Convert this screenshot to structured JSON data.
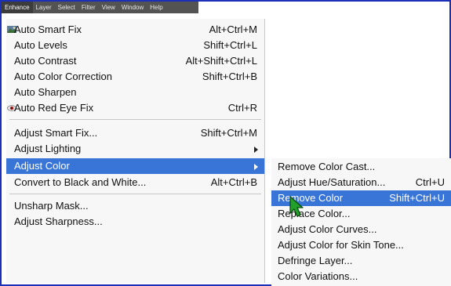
{
  "menubar": {
    "items": [
      "Enhance",
      "Layer",
      "Select",
      "Filter",
      "View",
      "Window",
      "Help"
    ]
  },
  "enhance_menu": {
    "items": [
      {
        "label": "Auto Smart Fix",
        "shortcut": "Alt+Ctrl+M",
        "icon": "auto-smart-fix-icon"
      },
      {
        "label": "Auto Levels",
        "shortcut": "Shift+Ctrl+L"
      },
      {
        "label": "Auto Contrast",
        "shortcut": "Alt+Shift+Ctrl+L"
      },
      {
        "label": "Auto Color Correction",
        "shortcut": "Shift+Ctrl+B"
      },
      {
        "label": "Auto Sharpen",
        "shortcut": ""
      },
      {
        "label": "Auto Red Eye Fix",
        "shortcut": "Ctrl+R",
        "icon": "red-eye-icon"
      },
      {
        "label": "Adjust Smart Fix...",
        "shortcut": "Shift+Ctrl+M"
      },
      {
        "label": "Adjust Lighting",
        "shortcut": "",
        "submenu": true
      },
      {
        "label": "Adjust Color",
        "shortcut": "",
        "submenu": true,
        "selected": true
      },
      {
        "label": "Convert to Black and White...",
        "shortcut": "Alt+Ctrl+B"
      },
      {
        "label": "Unsharp Mask...",
        "shortcut": ""
      },
      {
        "label": "Adjust Sharpness...",
        "shortcut": ""
      }
    ]
  },
  "adjust_color_submenu": {
    "items": [
      {
        "label": "Remove Color Cast...",
        "shortcut": ""
      },
      {
        "label": "Adjust Hue/Saturation...",
        "shortcut": "Ctrl+U"
      },
      {
        "label": "Remove Color",
        "shortcut": "Shift+Ctrl+U",
        "selected": true
      },
      {
        "label": "Replace Color...",
        "shortcut": ""
      },
      {
        "label": "Adjust Color Curves...",
        "shortcut": ""
      },
      {
        "label": "Adjust Color for Skin Tone...",
        "shortcut": ""
      },
      {
        "label": "Defringe Layer...",
        "shortcut": ""
      },
      {
        "label": "Color Variations...",
        "shortcut": ""
      }
    ]
  },
  "colors": {
    "selection": "#3875d7",
    "menubar": "#535353",
    "frame_border": "#1b2fb8",
    "cursor": "#22a02a"
  }
}
